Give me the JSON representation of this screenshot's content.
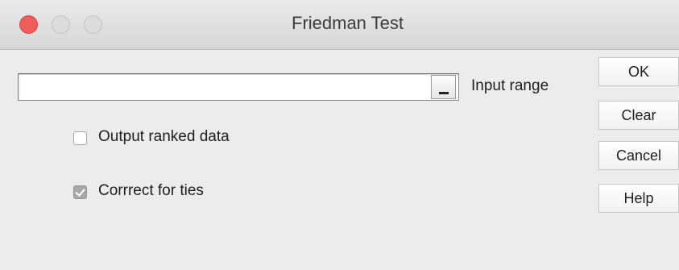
{
  "window": {
    "title": "Friedman Test"
  },
  "input_range": {
    "value": "",
    "label": "Input range",
    "picker_icon": "range-selector-icon"
  },
  "options": {
    "output_ranked": {
      "label": "Output ranked data",
      "checked": false
    },
    "correct_ties": {
      "label": "Corrrect for ties",
      "checked": true,
      "enabled": false
    }
  },
  "buttons": {
    "ok": "OK",
    "clear": "Clear",
    "cancel": "Cancel",
    "help": "Help"
  },
  "colors": {
    "close_button": "#ee5f5b",
    "window_bg": "#ececec"
  }
}
